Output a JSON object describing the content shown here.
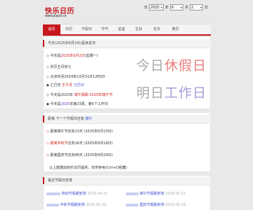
{
  "brand": {
    "title": "快乐日历",
    "url": "www.joyurl.cn"
  },
  "date_picker": {
    "prefix": "日",
    "year": "2025",
    "month": "6",
    "day": "2"
  },
  "nav": {
    "tabs": [
      "首页",
      "日历",
      "节假日",
      "节气",
      "星座",
      "生肖",
      "吉日",
      "黄历"
    ]
  },
  "holiday_panel": {
    "header": "今天(2025年6月2日)是休息日",
    "date_line": {
      "prefix": "今天是",
      "date": "2025年6月2日",
      "weekday": "(星期一)"
    },
    "lunar_line": "农历五月初七",
    "time_line": "北京时间2024年10月31日12时20",
    "ganzhi_line": {
      "prefix": "乙巳年",
      "a": "壬午月",
      "b": "己巳日"
    },
    "festival_line": {
      "prefix": "今天是2025年",
      "a": "端午假期",
      "b": "2025年端午节"
    },
    "week_line": {
      "prefix": "今天是",
      "year": "2025",
      "suffix": "年第23周，第5个工作日"
    },
    "big_today": {
      "a": "今日",
      "b": "休假日"
    },
    "big_tomorrow": {
      "a": "明日",
      "b": "工作日"
    }
  },
  "countdown_panel": {
    "header_prefix": "距离",
    "header_main": "下一个节假日还有",
    "header_link": "端午",
    "items": [
      {
        "label": "距离端午节还有13天 (2025年6月15日)"
      },
      {
        "a": "距离中秋节",
        "b": "还有",
        "c": "16天 (2025年6月18日)"
      },
      {
        "label": "距离国庆节还有88天 (2025年8月29日)"
      }
    ],
    "note": "以上数据由快乐日历提供，仅供参考(Ctrl+D收藏)"
  },
  "recent_panel": {
    "header": "最近节假日安排",
    "items": [
      {
        "name": "劳动节假期安排",
        "date": "2025-05-21"
      },
      {
        "name": "端午节假期安排",
        "date": "2025-05-21"
      },
      {
        "name": "中秋节假期安排",
        "date": "2025-05-20"
      },
      {
        "name": "国庆节假期安排",
        "date": "2025-05-16"
      }
    ]
  },
  "colors": {
    "brand_red": "#c8161d",
    "link_blue": "#3a4fd1",
    "purple": "#7a2fc8"
  }
}
